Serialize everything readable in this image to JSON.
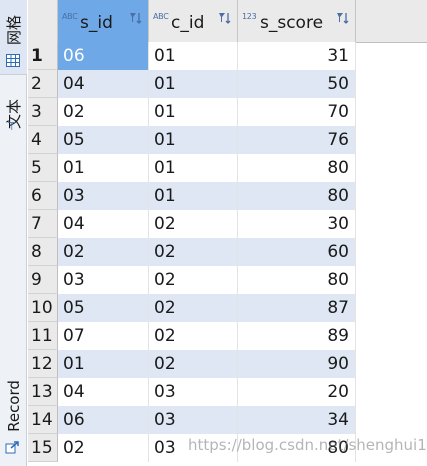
{
  "side_tabs": {
    "grid": "网格",
    "text": "文本",
    "record": "Record"
  },
  "columns": [
    {
      "type": "ABC",
      "name": "s_id"
    },
    {
      "type": "ABC",
      "name": "c_id"
    },
    {
      "type": "123",
      "name": "s_score"
    }
  ],
  "rows": [
    {
      "n": "1",
      "s_id": "06",
      "c_id": "01",
      "s_score": "31"
    },
    {
      "n": "2",
      "s_id": "04",
      "c_id": "01",
      "s_score": "50"
    },
    {
      "n": "3",
      "s_id": "02",
      "c_id": "01",
      "s_score": "70"
    },
    {
      "n": "4",
      "s_id": "05",
      "c_id": "01",
      "s_score": "76"
    },
    {
      "n": "5",
      "s_id": "01",
      "c_id": "01",
      "s_score": "80"
    },
    {
      "n": "6",
      "s_id": "03",
      "c_id": "01",
      "s_score": "80"
    },
    {
      "n": "7",
      "s_id": "04",
      "c_id": "02",
      "s_score": "30"
    },
    {
      "n": "8",
      "s_id": "02",
      "c_id": "02",
      "s_score": "60"
    },
    {
      "n": "9",
      "s_id": "03",
      "c_id": "02",
      "s_score": "80"
    },
    {
      "n": "10",
      "s_id": "05",
      "c_id": "02",
      "s_score": "87"
    },
    {
      "n": "11",
      "s_id": "07",
      "c_id": "02",
      "s_score": "89"
    },
    {
      "n": "12",
      "s_id": "01",
      "c_id": "02",
      "s_score": "90"
    },
    {
      "n": "13",
      "s_id": "04",
      "c_id": "03",
      "s_score": "20"
    },
    {
      "n": "14",
      "s_id": "06",
      "c_id": "03",
      "s_score": "34"
    },
    {
      "n": "15",
      "s_id": "02",
      "c_id": "03",
      "s_score": "80"
    }
  ],
  "selection": {
    "row": 1,
    "column": "s_id"
  },
  "watermark": "https://blog.csdn.net/shenghui1",
  "colors": {
    "selected": "#6fa8e6",
    "stripe": "#dfe7f4",
    "header": "#eaeaea"
  },
  "icons": {
    "grid_tab": "grid-icon",
    "text_tab": "text-format-icon",
    "record_tab": "record-icon",
    "sort": "sort-filter-icon"
  }
}
